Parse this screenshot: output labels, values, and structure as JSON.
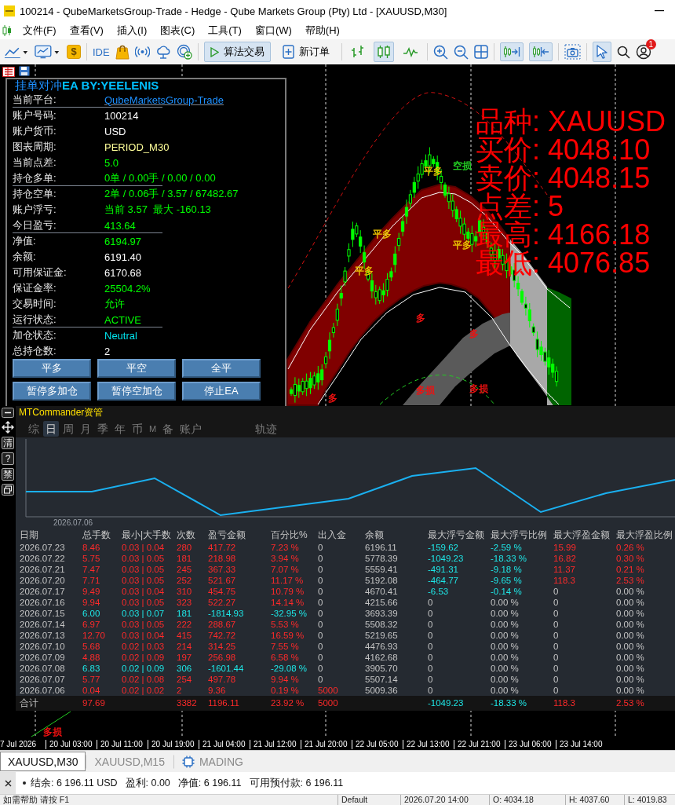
{
  "window": {
    "title": "100214 - QubeMarketsGroup-Trade - Hedge - Qube Markets Group (Pty) Ltd - [XAUUSD,M30]"
  },
  "menu": [
    "文件(F)",
    "查看(V)",
    "插入(I)",
    "图表(C)",
    "工具(T)",
    "窗口(W)",
    "帮助(H)"
  ],
  "toolbar": {
    "market_symbol": "$",
    "ide": "IDE",
    "algo_trading": {
      "label": "算法交易",
      "on": true
    },
    "new_order": "新订单",
    "chart_types": [
      {
        "selected": false
      },
      {
        "selected": true
      },
      {
        "selected": false
      }
    ],
    "auto_scroll": {
      "on": true
    },
    "chart_shift": {
      "on": true
    },
    "cursor": {
      "selected": true
    },
    "notification_count": "1"
  },
  "ea_panel": {
    "title": "挂单对冲**EA BY:YEELENIS**",
    "rows": [
      {
        "label": "当前平台:",
        "value": "QubeMarketsGroup-Trade",
        "color": "#1e90ff",
        "separator": true
      },
      {
        "label": "账户号码:",
        "value": "100214",
        "color": "#ffffff",
        "separator": false
      },
      {
        "label": "账户货币:",
        "value": "USD",
        "color": "#ffffff",
        "separator": false
      },
      {
        "label": "图表周期:",
        "value": "PERIOD_M30",
        "color": "#ffff99",
        "separator": false
      },
      {
        "label": "当前点差:",
        "value": "5.0",
        "color": "#00ff00",
        "separator": false
      },
      {
        "label": "持仓多单:",
        "value": "0单 / 0.00手 / 0.00 / 0.00",
        "color": "#00ff00",
        "separator": true
      },
      {
        "label": "持仓空单:",
        "value": "2单 / 0.06手 / 3.57 / 67482.67",
        "color": "#00ff00",
        "separator": false
      },
      {
        "label": "账户浮亏:",
        "value": "当前 3.57  最大 -160.13",
        "color": "#00ff00",
        "separator": false
      },
      {
        "label": "今日盈亏:",
        "value": "413.64",
        "color": "#00ff00",
        "separator": true
      },
      {
        "label": "净值:",
        "value": "6194.97",
        "color": "#00ff00",
        "separator": false
      },
      {
        "label": "余额:",
        "value": "6191.40",
        "color": "#ffffff",
        "separator": false
      },
      {
        "label": "可用保证金:",
        "value": "6170.68",
        "color": "#ffffff",
        "separator": false
      },
      {
        "label": "保证金率:",
        "value": "25504.2%",
        "color": "#00ff00",
        "separator": false
      },
      {
        "label": "交易时间:",
        "value": "允许",
        "color": "#00ff00",
        "separator": false
      },
      {
        "label": "运行状态:",
        "value": "ACTIVE",
        "color": "#00ff00",
        "separator": true
      },
      {
        "label": "加仓状态:",
        "value": "Neutral",
        "color": "#00e5ee",
        "separator": false
      },
      {
        "label": "总持仓数:",
        "value": "2",
        "color": "#ffffff",
        "separator": false
      }
    ],
    "buttons": [
      [
        "平多",
        "平空",
        "全平"
      ],
      [
        "暂停多加仓",
        "暂停空加仓",
        "停止EA"
      ]
    ]
  },
  "chart": {
    "labels": [
      {
        "text": "平多",
        "color": "#e8c000"
      },
      {
        "text": "平多",
        "color": "#e8c000"
      },
      {
        "text": "平多",
        "color": "#e8c000"
      },
      {
        "text": "平多",
        "color": "#e8c000"
      },
      {
        "text": "空损",
        "color": "#22cc22"
      },
      {
        "text": "多",
        "color": "#ee1111"
      },
      {
        "text": "多",
        "color": "#ee1111"
      },
      {
        "text": "多",
        "color": "#ee1111"
      },
      {
        "text": "多损",
        "color": "#ee1111"
      },
      {
        "text": "多损",
        "color": "#ee1111"
      },
      {
        "text": "多损",
        "color": "#ee1111"
      }
    ],
    "info": [
      {
        "label": "品种:",
        "value": "XAUUSD"
      },
      {
        "label": "买价:",
        "value": "4048.10"
      },
      {
        "label": "卖价:",
        "value": "4048.15"
      },
      {
        "label": "点差:",
        "value": "5"
      },
      {
        "label": "最高:",
        "value": "4166.18"
      },
      {
        "label": "最低:",
        "value": "4076.85"
      }
    ],
    "time_axis": [
      "7 Jul 2026",
      "20 Jul 03:00",
      "20 Jul 11:00",
      "20 Jul 19:00",
      "21 Jul 04:00",
      "21 Jul 12:00",
      "21 Jul 20:00",
      "22 Jul 05:00",
      "22 Jul 13:00",
      "22 Jul 21:00",
      "23 Jul 06:00",
      "23 Jul 14:00"
    ]
  },
  "commander": {
    "title": "MTCommander资管",
    "side_tools": [
      "清",
      "?",
      "禁"
    ],
    "tabs": [
      {
        "label": "综",
        "selected": false
      },
      {
        "label": "日",
        "selected": true
      },
      {
        "label": "周",
        "selected": false
      },
      {
        "label": "月",
        "selected": false
      },
      {
        "label": "季",
        "selected": false
      },
      {
        "label": "年",
        "selected": false
      },
      {
        "label": "币",
        "selected": false
      },
      {
        "label": "M",
        "selected": false
      },
      {
        "label": "备",
        "selected": false
      },
      {
        "label": "账户",
        "selected": false
      },
      {
        "label": "轨迹",
        "selected": false
      }
    ],
    "balance_chart": {
      "x_label": "2026.07.06"
    },
    "table": {
      "columns": [
        "日期",
        "总手数",
        "最小|大手数",
        "次数",
        "盈亏金额",
        "百分比%",
        "出入金",
        "余额",
        "最大浮亏金额",
        "最大浮亏比例",
        "最大浮盈金额",
        "最大浮盈比例"
      ],
      "rows": [
        {
          "cells": [
            "2026.07.23",
            "8.46",
            "0.03 | 0.04",
            "280",
            "417.72",
            "7.23 %",
            "0",
            "6196.11",
            "-159.62",
            "-2.59 %",
            "15.99",
            "0.26 %"
          ],
          "loss": false,
          "deposit_colored": false,
          "float_loss_colored": true,
          "float_profit_colored": true
        },
        {
          "cells": [
            "2026.07.22",
            "5.75",
            "0.03 | 0.05",
            "181",
            "218.98",
            "3.94 %",
            "0",
            "5778.39",
            "-1049.23",
            "-18.33 %",
            "16.82",
            "0.30 %"
          ],
          "loss": false,
          "deposit_colored": false,
          "float_loss_colored": true,
          "float_profit_colored": true
        },
        {
          "cells": [
            "2026.07.21",
            "7.47",
            "0.03 | 0.05",
            "245",
            "367.33",
            "7.07 %",
            "0",
            "5559.41",
            "-491.31",
            "-9.18 %",
            "11.37",
            "0.21 %"
          ],
          "loss": false,
          "deposit_colored": false,
          "float_loss_colored": true,
          "float_profit_colored": true
        },
        {
          "cells": [
            "2026.07.20",
            "7.71",
            "0.03 | 0.05",
            "252",
            "521.67",
            "11.17 %",
            "0",
            "5192.08",
            "-464.77",
            "-9.65 %",
            "118.3",
            "2.53 %"
          ],
          "loss": false,
          "deposit_colored": false,
          "float_loss_colored": true,
          "float_profit_colored": true
        },
        {
          "cells": [
            "2026.07.17",
            "9.49",
            "0.03 | 0.04",
            "310",
            "454.75",
            "10.79 %",
            "0",
            "4670.41",
            "-6.53",
            "-0.14 %",
            "0",
            "0.00 %"
          ],
          "loss": false,
          "deposit_colored": false,
          "float_loss_colored": true,
          "float_profit_colored": false
        },
        {
          "cells": [
            "2026.07.16",
            "9.94",
            "0.03 | 0.05",
            "323",
            "522.27",
            "14.14 %",
            "0",
            "4215.66",
            "0",
            "0.00 %",
            "0",
            "0.00 %"
          ],
          "loss": false,
          "deposit_colored": false,
          "float_loss_colored": false,
          "float_profit_colored": false
        },
        {
          "cells": [
            "2026.07.15",
            "6.00",
            "0.03 | 0.07",
            "181",
            "-1814.93",
            "-32.95 %",
            "0",
            "3693.39",
            "0",
            "0.00 %",
            "0",
            "0.00 %"
          ],
          "loss": true,
          "deposit_colored": false,
          "float_loss_colored": false,
          "float_profit_colored": false
        },
        {
          "cells": [
            "2026.07.14",
            "6.97",
            "0.03 | 0.05",
            "222",
            "288.67",
            "5.53 %",
            "0",
            "5508.32",
            "0",
            "0.00 %",
            "0",
            "0.00 %"
          ],
          "loss": false,
          "deposit_colored": false,
          "float_loss_colored": false,
          "float_profit_colored": false
        },
        {
          "cells": [
            "2026.07.13",
            "12.70",
            "0.03 | 0.04",
            "415",
            "742.72",
            "16.59 %",
            "0",
            "5219.65",
            "0",
            "0.00 %",
            "0",
            "0.00 %"
          ],
          "loss": false,
          "deposit_colored": false,
          "float_loss_colored": false,
          "float_profit_colored": false
        },
        {
          "cells": [
            "2026.07.10",
            "5.68",
            "0.02 | 0.03",
            "214",
            "314.25",
            "7.55 %",
            "0",
            "4476.93",
            "0",
            "0.00 %",
            "0",
            "0.00 %"
          ],
          "loss": false,
          "deposit_colored": false,
          "float_loss_colored": false,
          "float_profit_colored": false
        },
        {
          "cells": [
            "2026.07.09",
            "4.88",
            "0.02 | 0.09",
            "197",
            "256.98",
            "6.58 %",
            "0",
            "4162.68",
            "0",
            "0.00 %",
            "0",
            "0.00 %"
          ],
          "loss": false,
          "deposit_colored": false,
          "float_loss_colored": false,
          "float_profit_colored": false
        },
        {
          "cells": [
            "2026.07.08",
            "6.83",
            "0.02 | 0.09",
            "306",
            "-1601.44",
            "-29.08 %",
            "0",
            "3905.70",
            "0",
            "0.00 %",
            "0",
            "0.00 %"
          ],
          "loss": true,
          "deposit_colored": false,
          "float_loss_colored": false,
          "float_profit_colored": false
        },
        {
          "cells": [
            "2026.07.07",
            "5.77",
            "0.02 | 0.08",
            "254",
            "497.78",
            "9.94 %",
            "0",
            "5507.14",
            "0",
            "0.00 %",
            "0",
            "0.00 %"
          ],
          "loss": false,
          "deposit_colored": false,
          "float_loss_colored": false,
          "float_profit_colored": false
        },
        {
          "cells": [
            "2026.07.06",
            "0.04",
            "0.02 | 0.02",
            "2",
            "9.36",
            "0.19 %",
            "5000",
            "5009.36",
            "0",
            "0.00 %",
            "0",
            "0.00 %"
          ],
          "loss": false,
          "deposit_colored": true,
          "float_loss_colored": false,
          "float_profit_colored": false
        }
      ],
      "totals": {
        "label": "合计",
        "lots": "97.69",
        "trades": "3382",
        "pnl": "1196.11",
        "pct": "23.92 %",
        "deposit": "5000",
        "max_float_loss": "-1049.23",
        "max_float_loss_pct": "-18.33 %",
        "max_float_profit": "118.3",
        "max_float_profit_pct": "2.53 %",
        "loss": false,
        "deposit_colored": true,
        "float_loss_colored": true,
        "float_profit_colored": true
      }
    }
  },
  "chart_tabs": [
    {
      "label": "XAUUSD,M30",
      "selected": true,
      "kind": "chart"
    },
    {
      "label": "XAUUSD,M15",
      "selected": false,
      "kind": "chart"
    },
    {
      "label": "MADING",
      "selected": false,
      "kind": "program"
    }
  ],
  "account_bar": {
    "items": [
      "结余: 6 196.11 USD",
      "盈利: 0.00",
      "净值: 6 196.11",
      "可用预付款: 6 196.11"
    ]
  },
  "status_bar": [
    "如需帮助 请按 F1",
    "Default",
    "2026.07.20 14:00",
    "O: 4034.18",
    "H: 4037.60",
    "L: 4019.83"
  ]
}
